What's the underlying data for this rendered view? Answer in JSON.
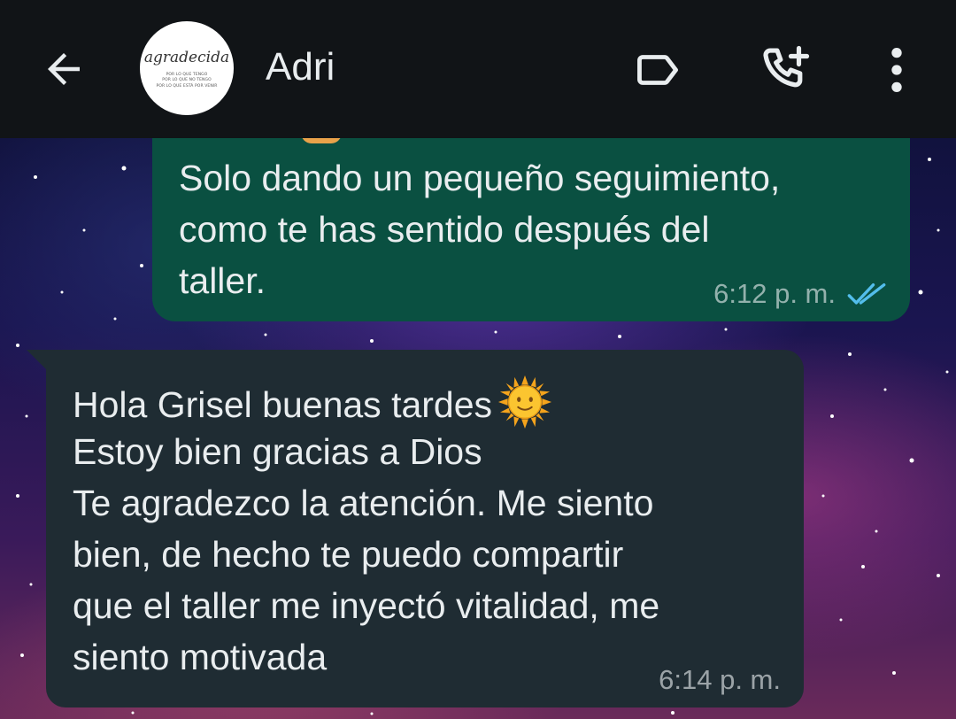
{
  "header": {
    "contact_name": "Adri",
    "avatar": {
      "brand": "agradecida",
      "lines": [
        "POR LO QUE TENGO",
        "POR LO QUE NO TENGO",
        "POR LO QUE ESTÁ POR VENIR"
      ]
    },
    "icons": {
      "back": "arrow-left-icon",
      "label": "label-tag-icon",
      "call": "add-call-icon",
      "menu": "more-vert-icon"
    }
  },
  "messages": [
    {
      "direction": "outgoing",
      "text": "Solo dando un pequeño seguimiento,\ncomo te has sentido después del\ntaller.",
      "time": "6:12 p. m.",
      "status": "read",
      "status_icon": "double-check-icon"
    },
    {
      "direction": "incoming",
      "lines": [
        "Hola Grisel buenas tardes",
        "Estoy bien gracias a Dios",
        "Te agradezco la atención. Me siento",
        "bien, de hecho te puedo compartir",
        "que el taller me inyectó vitalidad, me",
        "siento motivada"
      ],
      "emoji": "sun-with-face-icon",
      "time": "6:14 p. m."
    }
  ],
  "colors": {
    "header_bg": "#111417",
    "outgoing_bubble": "#0a5041",
    "incoming_bubble": "#1f2c33",
    "text": "#e9edef",
    "read_tick": "#53bdeb"
  }
}
